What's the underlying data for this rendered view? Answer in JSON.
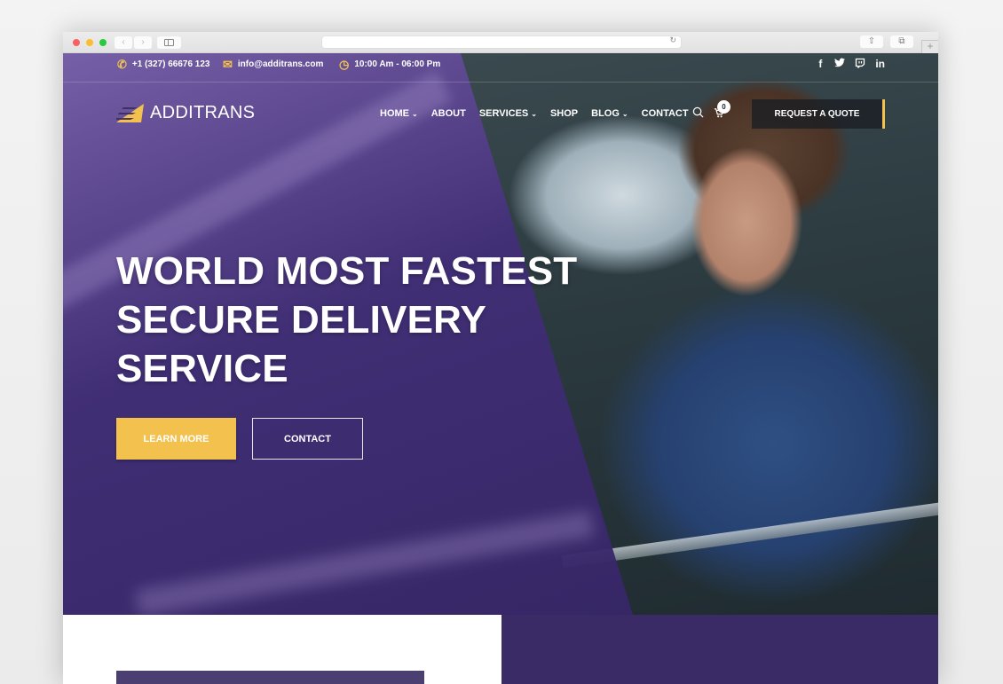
{
  "browser": {
    "url": "",
    "back_icon": "‹",
    "forward_icon": "›",
    "reload_icon": "↻",
    "share_icon": "⇧",
    "tabs_icon": "⧉",
    "new_tab_icon": "+"
  },
  "topbar": {
    "phone": "+1 (327) 66676 123",
    "email": "info@additrans.com",
    "hours": "10:00 Am - 06:00 Pm",
    "socials": [
      {
        "name": "facebook",
        "glyph": "f"
      },
      {
        "name": "twitter",
        "glyph": "🐦"
      },
      {
        "name": "twitch",
        "glyph": "▢"
      },
      {
        "name": "linkedin",
        "glyph": "in"
      }
    ]
  },
  "header": {
    "logo_text": "ADDITRANS",
    "nav": [
      {
        "label": "HOME",
        "dropdown": true
      },
      {
        "label": "ABOUT",
        "dropdown": false
      },
      {
        "label": "SERVICES",
        "dropdown": true
      },
      {
        "label": "SHOP",
        "dropdown": false
      },
      {
        "label": "BLOG",
        "dropdown": true
      },
      {
        "label": "CONTACT",
        "dropdown": false
      }
    ],
    "cart_count": "0",
    "quote_button": "REQUEST A QUOTE"
  },
  "hero": {
    "headline_lines": [
      "WORLD MOST FASTEST",
      "SECURE DELIVERY",
      "SERVICE"
    ],
    "primary_button": "LEARN MORE",
    "secondary_button": "CONTACT"
  },
  "colors": {
    "accent": "#f2c14e",
    "brand_purple": "#3a2b66",
    "overlay_purple": "#4a3585"
  }
}
